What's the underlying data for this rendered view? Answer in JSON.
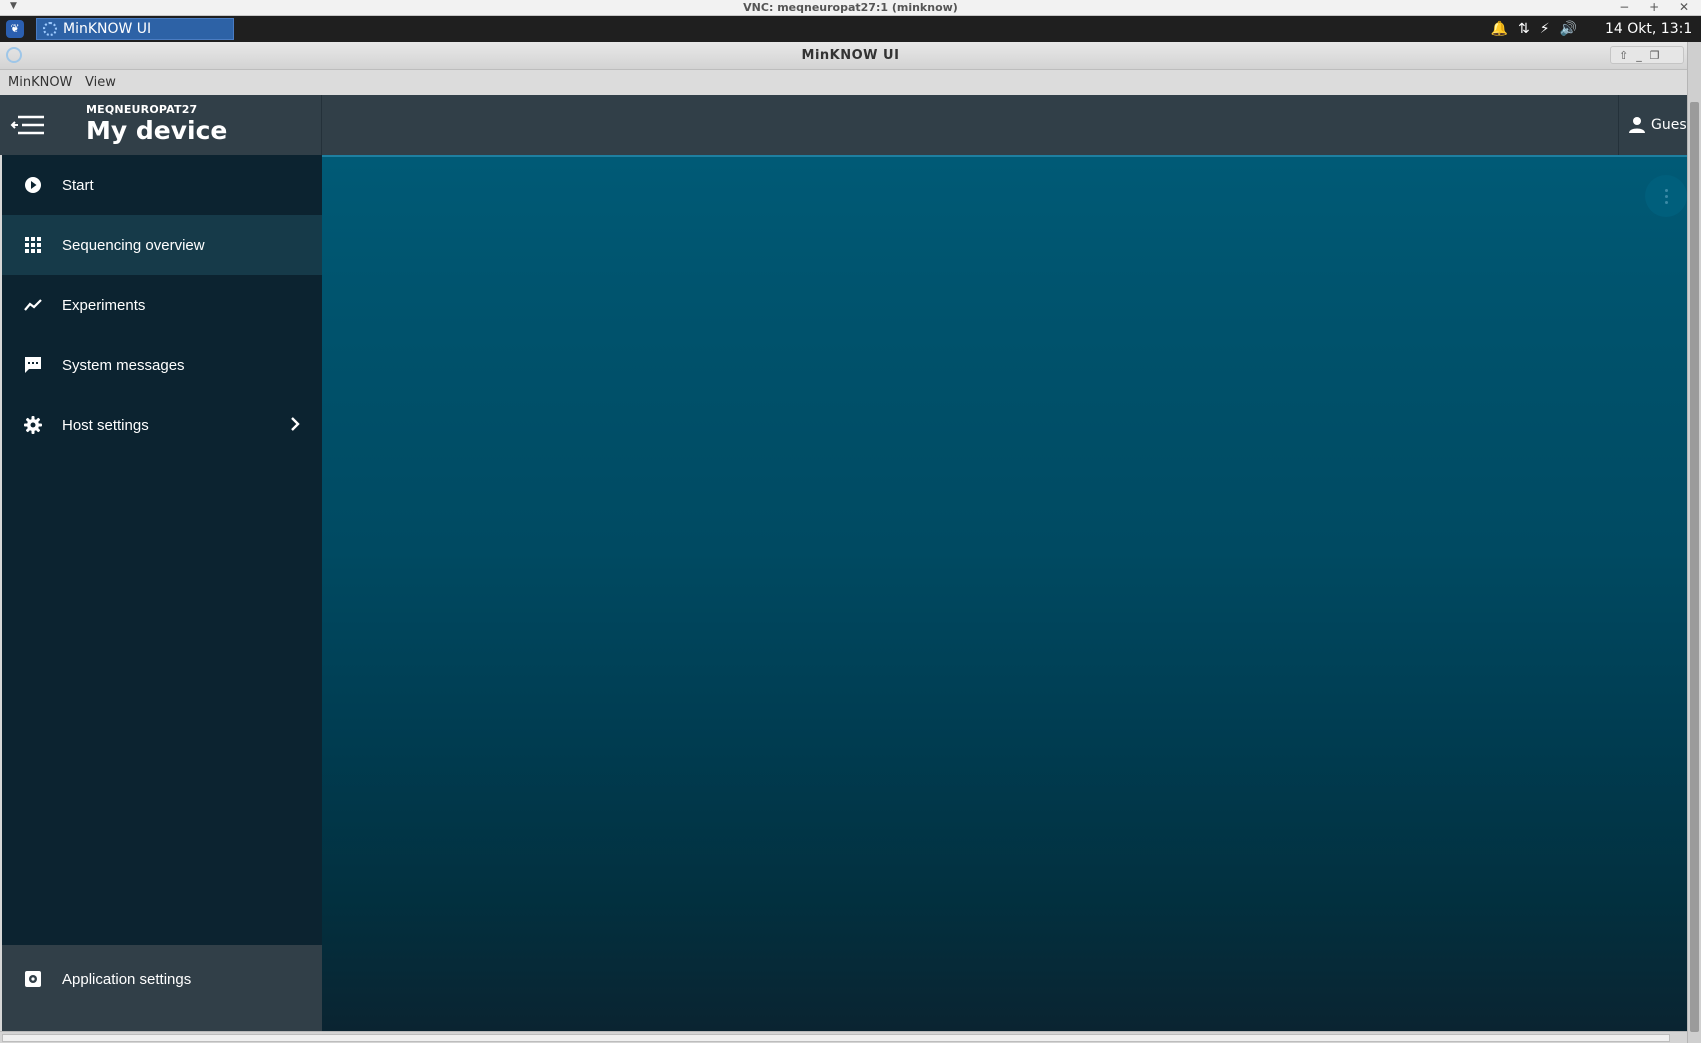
{
  "vnc": {
    "title": "VNC: meqneuropat27:1 (minknow)",
    "controls": "− + ✕"
  },
  "taskbar": {
    "task_label": "MinKNOW UI",
    "clock": "14 Okt, 13:1"
  },
  "window": {
    "title": "MinKNOW UI"
  },
  "menubar": {
    "items": [
      "MinKNOW",
      "View"
    ]
  },
  "header": {
    "host": "MEQNEUROPAT27",
    "device_title": "My device",
    "user_label": "Guest"
  },
  "sidebar": {
    "items": [
      {
        "label": "Start",
        "icon": "play-circle-icon"
      },
      {
        "label": "Sequencing overview",
        "icon": "grid-icon",
        "active": true
      },
      {
        "label": "Experiments",
        "icon": "trend-line-icon"
      },
      {
        "label": "System messages",
        "icon": "message-icon"
      },
      {
        "label": "Host settings",
        "icon": "gear-icon",
        "has_submenu": true
      }
    ],
    "footer": {
      "label": "Application settings",
      "icon": "settings-box-icon"
    }
  },
  "colors": {
    "sidebar_bg": "#0c2330",
    "sidebar_active": "#163a49",
    "header_bg": "#313f48",
    "main_top": "#005a76",
    "main_bottom": "#0a2431"
  }
}
